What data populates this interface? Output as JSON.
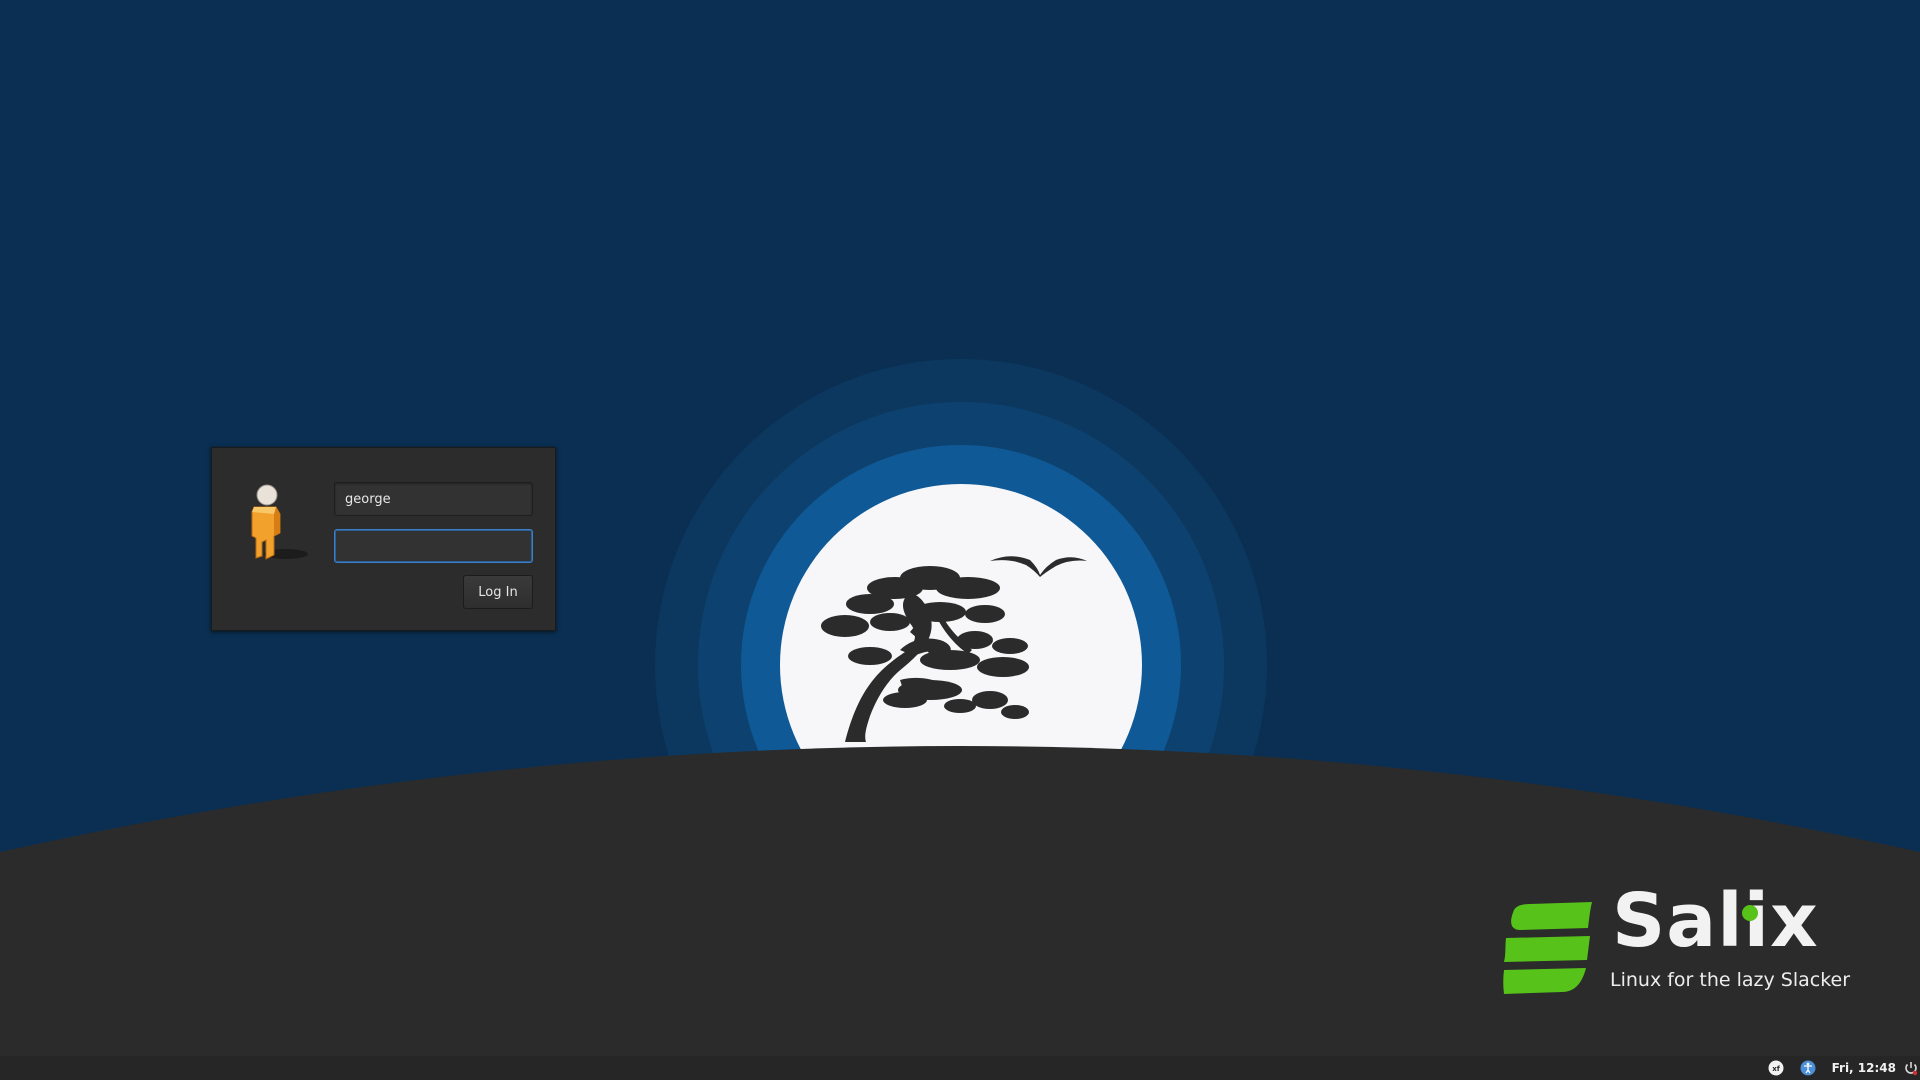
{
  "login": {
    "username_value": "george",
    "password_value": "",
    "login_button_label": "Log In"
  },
  "branding": {
    "name": "Salix",
    "tagline": "Linux for the lazy Slacker"
  },
  "panel": {
    "clock": "Fri, 12:48",
    "tray_icons": [
      "xfce-icon",
      "accessibility-icon",
      "power-icon"
    ]
  },
  "colors": {
    "background": "#0a2f52",
    "ground": "#2b2b2b",
    "moon": "#f7f7f9",
    "logo_green": "#56c21a",
    "focus_border": "#3d7ec8"
  }
}
